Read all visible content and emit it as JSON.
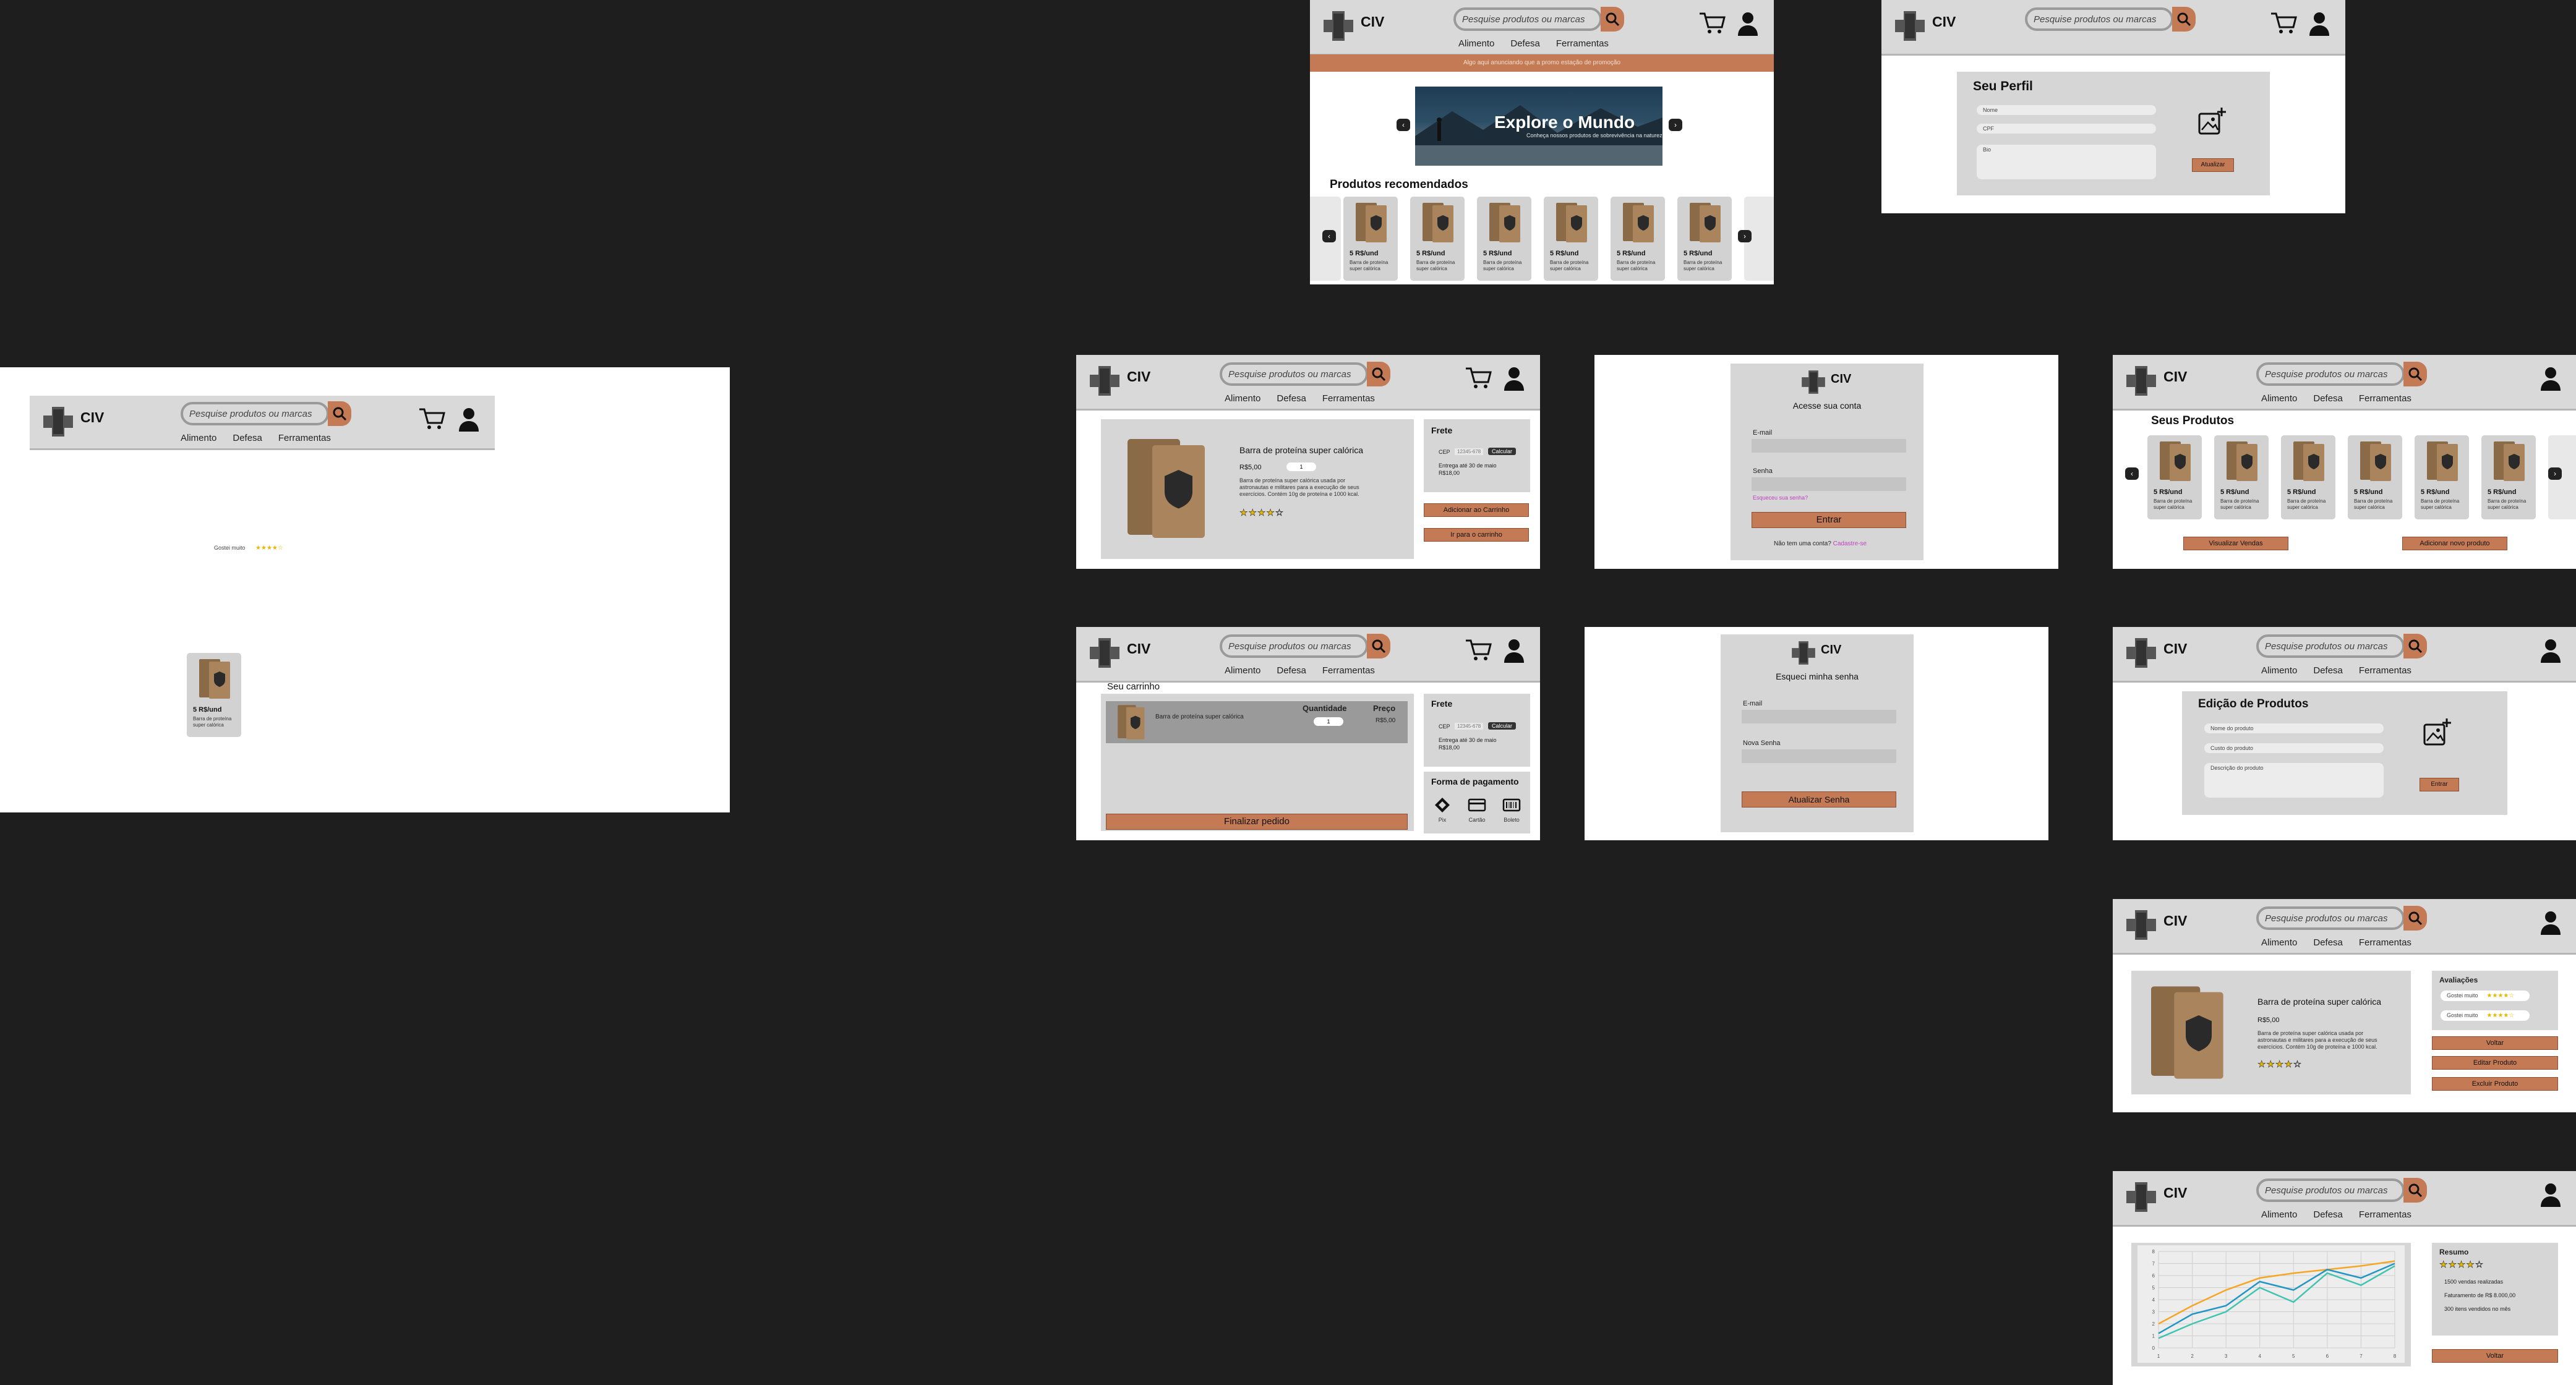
{
  "common": {
    "brand": "CIV",
    "search_placeholder": "Pesquise produtos ou marcas",
    "nav": [
      "Alimento",
      "Defesa",
      "Ferramentas"
    ]
  },
  "product": {
    "name": "Barra de proteína super calórica",
    "price": "R$5,00",
    "unit_price": "5 R$/und",
    "short_desc": "Barra de proteína super calórica",
    "description": "Barra de proteína super calórica usada por astronautas e militares para a execução de seus exercícios. Contém 10g de proteína e 1000 kcal.",
    "quantity": "1",
    "rating": "★★★★☆"
  },
  "home": {
    "promo_bar": "Algo aqui anunciando que a promo estação de promoção",
    "banner_title": "Explore o Mundo",
    "banner_subtitle": "Conheça nossos produtos de sobrevivência na natureza",
    "section_title": "Produtos recomendados",
    "prev": "‹",
    "next": "›"
  },
  "profile": {
    "title": "Seu Perfil",
    "name_ph": "Nome",
    "cpf_ph": "CPF",
    "bio_ph": "Bio",
    "update_btn": "Atualizar"
  },
  "product_page": {
    "frete": "Frete",
    "cep_label": "CEP",
    "cep_value": "12345-678",
    "calc_btn": "Calcular",
    "delivery": "Entrega até 30 de maio",
    "delivery_price": "R$18,00",
    "add_cart": "Adicionar ao Carrinho",
    "go_cart": "Ir para o carrinho"
  },
  "login": {
    "title": "Acesse sua conta",
    "email_label": "E-mail",
    "pass_label": "Senha",
    "forgot": "Esqueceu sua senha?",
    "enter_btn": "Entrar",
    "no_account": "Não tem uma conta?",
    "signup": "Cadastre-se"
  },
  "seller": {
    "title": "Seus Produtos",
    "view_sales": "Visualizar Vendas",
    "add_product": "Adicionar novo produto"
  },
  "cart": {
    "title": "Seu carrinho",
    "qty_header": "Quantidade",
    "price_header": "Preço",
    "finish": "Finalizar pedido",
    "payment_title": "Forma de pagamento",
    "pay_methods": [
      "Pix",
      "Cartão",
      "Boleto"
    ]
  },
  "forgot": {
    "title": "Esqueci minha senha",
    "email_label": "E-mail",
    "new_pass": "Nova Senha",
    "update_btn": "Atualizar Senha"
  },
  "edit": {
    "title": "Edição de Produtos",
    "name_ph": "Nome do produto",
    "cost_ph": "Custo do produto",
    "desc_ph": "Descrição do produto",
    "enter_btn": "Entrar"
  },
  "seller_product": {
    "reviews_title": "Avaliações",
    "review_label": "Gostei muito",
    "back": "Voltar",
    "edit": "Editar Produto",
    "delete": "Excluir Produto"
  },
  "dashboard": {
    "summary_title": "Resumo",
    "sales": "1500 vendas realizadas",
    "revenue": "Faturamento de R$ 8.000,00",
    "recent": "300 itens vendidos no mês",
    "back": "Voltar"
  },
  "review_frame": {
    "review_label": "Gostei muito"
  },
  "chart_data": {
    "type": "line",
    "x": [
      1,
      2,
      3,
      4,
      5,
      6,
      7,
      8
    ],
    "series": [
      {
        "values": [
          2,
          3.5,
          4.8,
          5.8,
          6.2,
          6.5,
          6.8,
          7.2
        ]
      },
      {
        "values": [
          1.2,
          2.8,
          3.5,
          5.5,
          4.8,
          6.5,
          5.8,
          7.0
        ]
      },
      {
        "values": [
          0.8,
          2.0,
          3.0,
          5.0,
          3.8,
          6.2,
          5.2,
          6.8
        ]
      }
    ],
    "colors": [
      "#f5a623",
      "#2196c4",
      "#40c4b0"
    ],
    "ylim": [
      0,
      8
    ],
    "grid": true
  }
}
